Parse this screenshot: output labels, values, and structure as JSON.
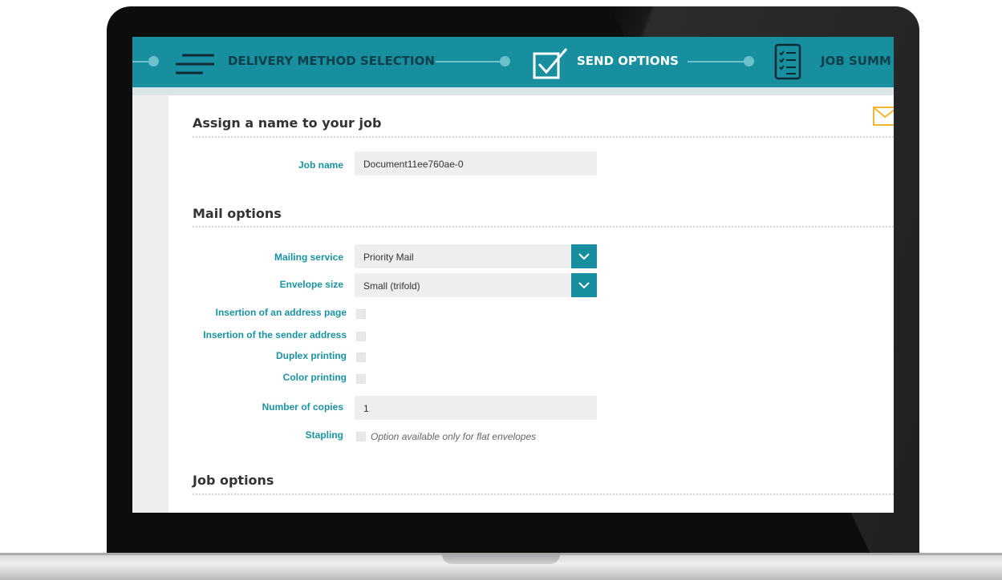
{
  "steps": [
    {
      "label": "DELIVERY METHOD SELECTION",
      "icon": "menu-lines-icon",
      "state": "done"
    },
    {
      "label": "SEND OPTIONS",
      "icon": "checkbox-check-icon",
      "state": "active"
    },
    {
      "label": "JOB SUMM",
      "icon": "checklist-icon",
      "state": "upcoming"
    }
  ],
  "sections": {
    "job_name_title": "Assign a name to your job",
    "mail_options_title": "Mail options",
    "job_options_title": "Job options"
  },
  "job_name": {
    "label": "Job name",
    "value": "Document11ee760ae-0"
  },
  "mail": {
    "service_label": "Mailing service",
    "service_value": "Priority Mail",
    "envelope_label": "Envelope size",
    "envelope_value": "Small (trifold)",
    "address_page_label": "Insertion of an address page",
    "sender_address_label": "Insertion of the sender address",
    "duplex_label": "Duplex printing",
    "color_label": "Color printing",
    "copies_label": "Number of copies",
    "copies_value": "1",
    "stapling_label": "Stapling",
    "stapling_hint": "Option available only for flat envelopes"
  },
  "colors": {
    "accent": "#188f9f",
    "label_text": "#1a93a3",
    "envelope_icon": "#f2b632"
  },
  "icons": [
    "menu-lines-icon",
    "checkbox-check-icon",
    "checklist-icon",
    "envelope-icon",
    "chevron-down-icon"
  ]
}
